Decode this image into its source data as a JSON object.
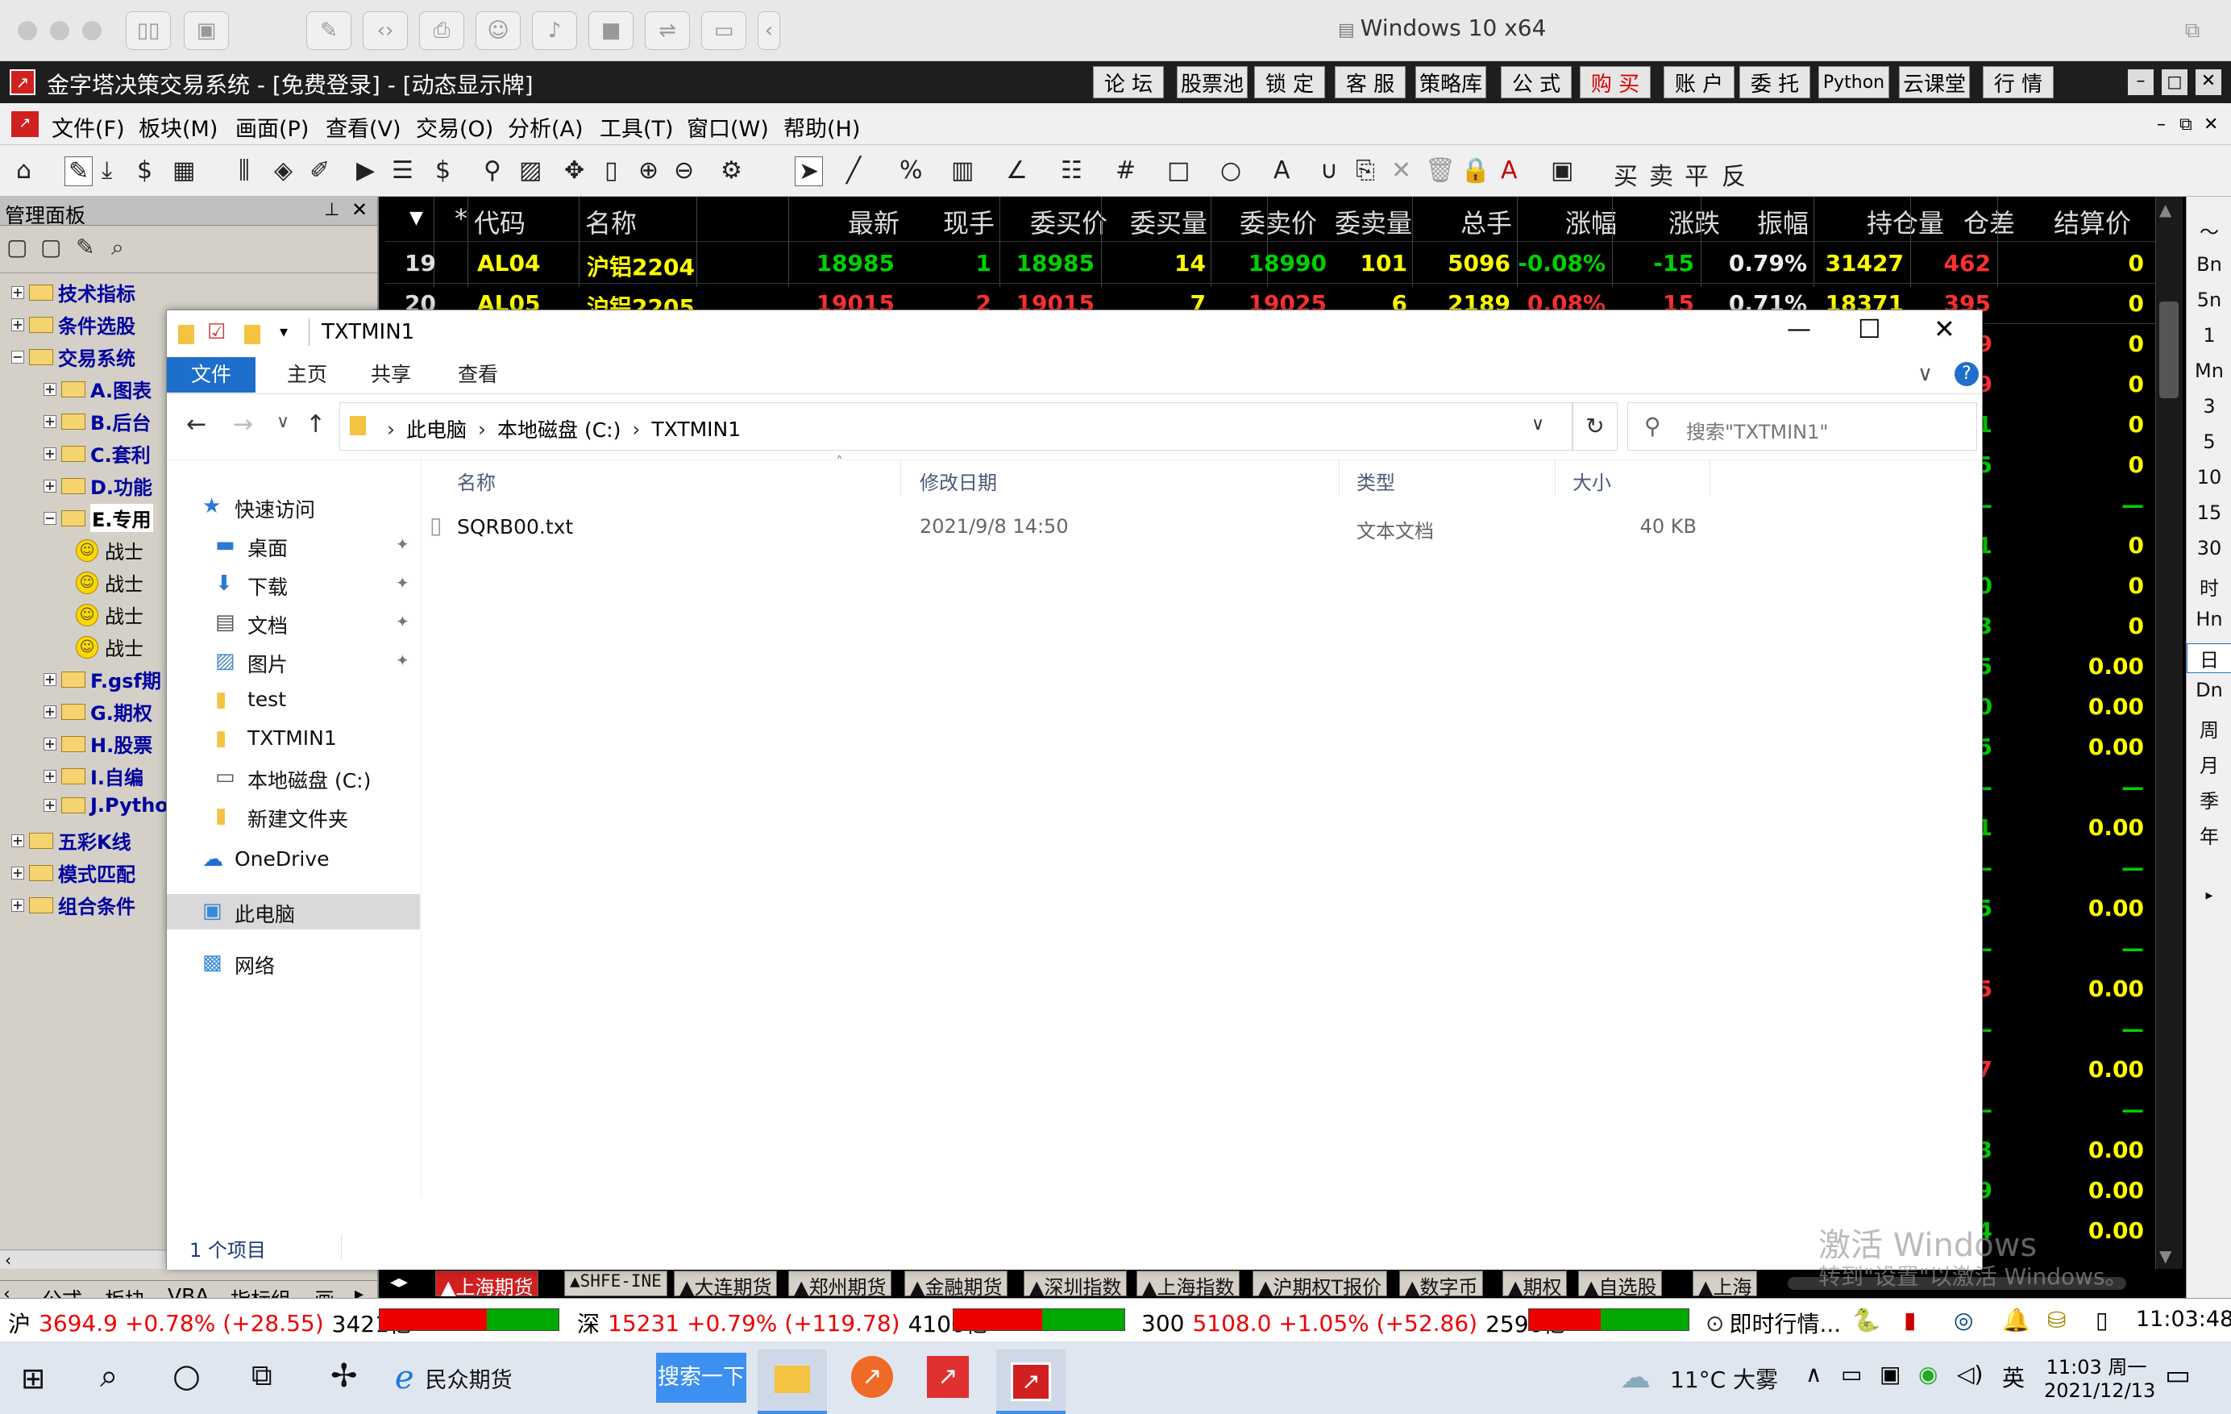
{
  "mac": {
    "title": "Windows 10 x64"
  },
  "app": {
    "title": "金字塔决策交易系统 - [免费登录] - [动态显示牌]",
    "top_buttons": [
      "论 坛",
      "股票池",
      "锁 定",
      "客 服",
      "策略库",
      "公 式",
      "购 买",
      "账 户",
      "委 托",
      "Python",
      "云课堂",
      "行 情"
    ]
  },
  "menu": [
    "文件(F)",
    "板块(M)",
    "画面(P)",
    "查看(V)",
    "交易(O)",
    "分析(A)",
    "工具(T)",
    "窗口(W)",
    "帮助(H)"
  ],
  "panel": {
    "title": "管理面板",
    "tree": [
      {
        "label": "技术指标",
        "type": "folder",
        "indent": 0
      },
      {
        "label": "条件选股",
        "type": "folder",
        "indent": 0
      },
      {
        "label": "交易系统",
        "type": "folder",
        "indent": 0
      },
      {
        "label": "A.图表",
        "type": "folder",
        "indent": 1
      },
      {
        "label": "B.后台",
        "type": "folder",
        "indent": 1
      },
      {
        "label": "C.套利",
        "type": "folder",
        "indent": 1
      },
      {
        "label": "D.功能",
        "type": "folder",
        "indent": 1
      },
      {
        "label": "E.专用",
        "type": "folder-open",
        "indent": 1
      },
      {
        "label": "战士",
        "type": "smiley",
        "indent": 2
      },
      {
        "label": "战士",
        "type": "smiley",
        "indent": 2
      },
      {
        "label": "战士",
        "type": "smiley",
        "indent": 2
      },
      {
        "label": "战士",
        "type": "smiley",
        "indent": 2
      },
      {
        "label": "F.gsf期",
        "type": "folder",
        "indent": 1
      },
      {
        "label": "G.期权",
        "type": "folder",
        "indent": 1
      },
      {
        "label": "H.股票",
        "type": "folder",
        "indent": 1
      },
      {
        "label": "I.自编",
        "type": "folder",
        "indent": 1
      },
      {
        "label": "J.Pytho",
        "type": "folder",
        "indent": 1
      },
      {
        "label": "五彩K线",
        "type": "folder",
        "indent": 0
      },
      {
        "label": "模式匹配",
        "type": "folder",
        "indent": 0
      },
      {
        "label": "组合条件",
        "type": "folder",
        "indent": 0
      }
    ],
    "bottom_tabs": [
      "公式",
      "板块",
      "VBA",
      "指标组",
      "画"
    ]
  },
  "market": {
    "headers": [
      "*",
      "代码",
      "名称",
      "最新",
      "现手",
      "委买价",
      "委买量",
      "委卖价",
      "委卖量",
      "总手",
      "涨幅",
      "涨跌",
      "振幅",
      "持仓量",
      "仓差",
      "结算价"
    ],
    "rows": [
      {
        "no": "19",
        "code": "AL04",
        "name": "沪铝2204",
        "last": "18985",
        "vol": "1",
        "bid": "18985",
        "bidv": "14",
        "ask": "18990",
        "askv": "101",
        "total": "5096",
        "pct": "-0.08%",
        "chg": "-15",
        "amp": "0.79%",
        "oi": "31427",
        "oid": "462",
        "settle": "0"
      },
      {
        "no": "20",
        "code": "AL05",
        "name": "沪铝2205",
        "last": "19015",
        "vol": "2",
        "bid": "19015",
        "bidv": "7",
        "ask": "19025",
        "askv": "6",
        "total": "2189",
        "pct": "0.08%",
        "chg": "15",
        "amp": "0.71%",
        "oi": "18371",
        "oid": "395",
        "settle": "0"
      }
    ],
    "right_col_rows": [
      {
        "oid": "39",
        "settle": "0"
      },
      {
        "oid": "29",
        "settle": "0"
      },
      {
        "oid": "-291",
        "settle": "0"
      },
      {
        "oid": "-5",
        "settle": "0"
      },
      {
        "oid": "—",
        "settle": "—"
      },
      {
        "oid": "-1",
        "settle": "0"
      },
      {
        "oid": "-2700",
        "settle": "0"
      },
      {
        "oid": "-1323",
        "settle": "0"
      },
      {
        "oid": "-2335",
        "settle": "0.00"
      },
      {
        "oid": "-30",
        "settle": "0.00"
      },
      {
        "oid": "-2335",
        "settle": "0.00"
      },
      {
        "oid": "—",
        "settle": "—"
      },
      {
        "oid": "-271",
        "settle": "0.00"
      },
      {
        "oid": "—",
        "settle": "—"
      },
      {
        "oid": "-585",
        "settle": "0.00"
      },
      {
        "oid": "—",
        "settle": "—"
      },
      {
        "oid": "85",
        "settle": "0.00"
      },
      {
        "oid": "—",
        "settle": "—"
      },
      {
        "oid": "7",
        "settle": "0.00"
      },
      {
        "oid": "—",
        "settle": "—"
      },
      {
        "oid": "-93",
        "settle": "0.00"
      },
      {
        "oid": "-3219",
        "settle": "0.00"
      },
      {
        "oid": "-6574",
        "settle": "0.00"
      }
    ],
    "tabs": [
      "▲上海期货",
      "▲SHFE-INE",
      "▲大连期货",
      "▲郑州期货",
      "▲金融期货",
      "▲深圳指数",
      "▲上海指数",
      "▲沪期权T报价",
      "▲数字币",
      "▲期权",
      "▲自选股",
      "▲上海"
    ]
  },
  "rightbar": [
    "Bn",
    "5n",
    "1",
    "Mn",
    "3",
    "5",
    "10",
    "15",
    "30",
    "时",
    "Hn",
    "日",
    "Dn",
    "周",
    "月",
    "季",
    "年"
  ],
  "explorer": {
    "title": "TXTMIN1",
    "ribbon_tabs": [
      "文件",
      "主页",
      "共享",
      "查看"
    ],
    "breadcrumb": [
      "此电脑",
      "本地磁盘 (C:)",
      "TXTMIN1"
    ],
    "search_placeholder": "搜索\"TXTMIN1\"",
    "nav": [
      {
        "label": "快速访问",
        "icon": "star-icon",
        "indent": 0,
        "pin": false
      },
      {
        "label": "桌面",
        "icon": "desktop-icon",
        "indent": 1,
        "pin": true
      },
      {
        "label": "下载",
        "icon": "download-icon",
        "indent": 1,
        "pin": true
      },
      {
        "label": "文档",
        "icon": "document-icon",
        "indent": 1,
        "pin": true
      },
      {
        "label": "图片",
        "icon": "picture-icon",
        "indent": 1,
        "pin": true
      },
      {
        "label": "test",
        "icon": "folder-icon",
        "indent": 1,
        "pin": false
      },
      {
        "label": "TXTMIN1",
        "icon": "folder-icon",
        "indent": 1,
        "pin": false
      },
      {
        "label": "本地磁盘 (C:)",
        "icon": "drive-icon",
        "indent": 1,
        "pin": false
      },
      {
        "label": "新建文件夹",
        "icon": "folder-icon",
        "indent": 1,
        "pin": false
      },
      {
        "label": "OneDrive",
        "icon": "cloud-icon",
        "indent": 0,
        "pin": false
      },
      {
        "label": "此电脑",
        "icon": "computer-icon",
        "indent": 0,
        "pin": false,
        "selected": true
      },
      {
        "label": "网络",
        "icon": "network-icon",
        "indent": 0,
        "pin": false
      }
    ],
    "columns": [
      "名称",
      "修改日期",
      "类型",
      "大小"
    ],
    "files": [
      {
        "name": "SQRB00.txt",
        "date": "2021/9/8 14:50",
        "type": "文本文档",
        "size": "40 KB"
      }
    ],
    "status": "1 个项目"
  },
  "watermark": {
    "line1": "激活 Windows",
    "line2": "转到\"设置\"以激活 Windows。"
  },
  "status": {
    "sh_label": "沪",
    "sh": "3694.9 +0.78% (+28.55)",
    "sh_amt": "3421亿",
    "sz_label": "深",
    "sz": "15231 +0.79% (+119.78)",
    "sz_amt": "4100亿",
    "c300_label": "300",
    "c300": "5108.0 +1.05% (+52.86)",
    "c300_amt": "2596亿",
    "news": "即时行情...",
    "time": "11:03:48"
  },
  "taskbar": {
    "ie_label": "民众期货",
    "search_btn": "搜索一下",
    "weather": "11°C 大雾",
    "ime": "英",
    "clock_time": "11:03 周一",
    "clock_date": "2021/12/13"
  },
  "colors": {
    "up": "#ff3030",
    "down": "#00d000",
    "yellow": "#ffff00",
    "accent": "#1e6fcc"
  }
}
